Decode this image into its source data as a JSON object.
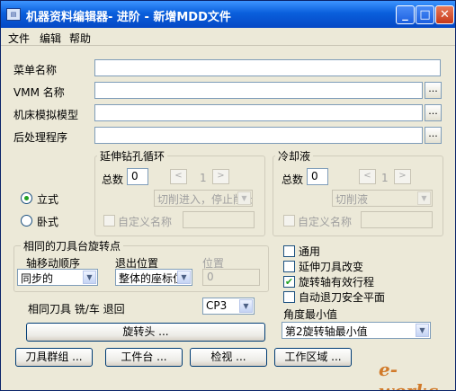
{
  "window": {
    "title": "机器资料编辑器- 进阶 - 新增MDD文件",
    "app_icon": "app-icon",
    "min": "_",
    "max": "□",
    "close": "✕"
  },
  "menu": [
    "文件",
    "编辑",
    "帮助"
  ],
  "fields": {
    "menu_name_label": "菜单名称",
    "vmm_label": "VMM 名称",
    "machine_label": "机床模拟模型",
    "post_label": "后处理程序",
    "browse": "..."
  },
  "orientation": {
    "vertical": "立式",
    "horizontal": "卧式",
    "selected": "vertical"
  },
  "drill_cycle": {
    "title": "延伸钻孔循环",
    "count_label": "总数",
    "count_value": "0",
    "counter": "1",
    "prev": "<",
    "next": ">",
    "combo_value": "切削进入，停止削出",
    "custom_name_label": "自定义名称"
  },
  "coolant": {
    "title": "冷却液",
    "count_label": "总数",
    "count_value": "0",
    "counter": "1",
    "prev": "<",
    "next": ">",
    "combo_value": "切削液",
    "custom_name_label": "自定义名称"
  },
  "turret": {
    "title": "相同的刀具台旋转点",
    "axis_order_label": "轴移动顺序",
    "axis_order_value": "同步的",
    "exit_pos_label": "退出位置",
    "exit_pos_value": "整体的座标位",
    "pos_label": "位置",
    "pos_value": "0"
  },
  "options": [
    {
      "label": "通用",
      "checked": false
    },
    {
      "label": "延伸刀具改变",
      "checked": false
    },
    {
      "label": "旋转轴有效行程",
      "checked": true
    },
    {
      "label": "自动退刀安全平面",
      "checked": false
    }
  ],
  "retract": {
    "label": "相同刀具 铣/车 退回",
    "value": "CP3"
  },
  "angle_min": {
    "label": "角度最小值",
    "value": "第2旋转轴最小值"
  },
  "rotary_head_button": "旋转头 ...",
  "bottom_buttons": [
    "刀具群组 ...",
    "工件台 ...",
    "检视 ...",
    "工作区域 ..."
  ],
  "watermark": "e-works"
}
